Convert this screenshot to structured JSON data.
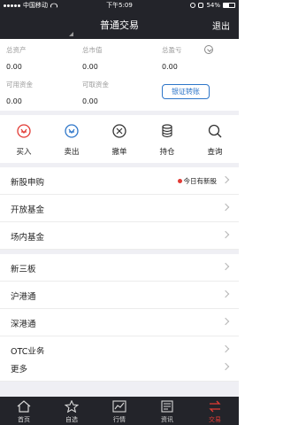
{
  "status_bar": {
    "carrier": "中国移动",
    "time": "下午5:09",
    "battery_text": "54%",
    "battery_level": 0.54
  },
  "nav": {
    "title": "普通交易",
    "exit_label": "退出"
  },
  "summary": {
    "total_assets_label": "总资产",
    "total_assets_value": "0.00",
    "market_value_label": "总市值",
    "market_value_value": "0.00",
    "pnl_label": "总盈亏",
    "pnl_value": "0.00",
    "available_label": "可用资金",
    "available_value": "0.00",
    "withdrawable_label": "可取资金",
    "withdrawable_value": "0.00",
    "transfer_label": "银证转账"
  },
  "actions": [
    {
      "label": "买入",
      "icon": "buy-icon"
    },
    {
      "label": "卖出",
      "icon": "sell-icon"
    },
    {
      "label": "撤单",
      "icon": "cancel-order-icon"
    },
    {
      "label": "持仓",
      "icon": "holdings-icon"
    },
    {
      "label": "查询",
      "icon": "search-icon"
    }
  ],
  "menu": {
    "ipo": "新股申购",
    "ipo_notice": "今日有新股",
    "open_fund": "开放基金",
    "exchange_fund": "场内基金",
    "neeq": "新三板",
    "sh_hk": "沪港通",
    "sz_hk": "深港通",
    "otc": "OTC业务",
    "more": "更多"
  },
  "tabs": [
    {
      "label": "首页",
      "icon": "home-icon"
    },
    {
      "label": "自选",
      "icon": "star-icon"
    },
    {
      "label": "行情",
      "icon": "chart-icon"
    },
    {
      "label": "资讯",
      "icon": "news-icon"
    },
    {
      "label": "交易",
      "icon": "trade-icon",
      "active": true
    }
  ],
  "colors": {
    "dark_bar": "#23242a",
    "accent_blue": "#2e76c9",
    "accent_red": "#e23b35",
    "background": "#efeff4"
  }
}
